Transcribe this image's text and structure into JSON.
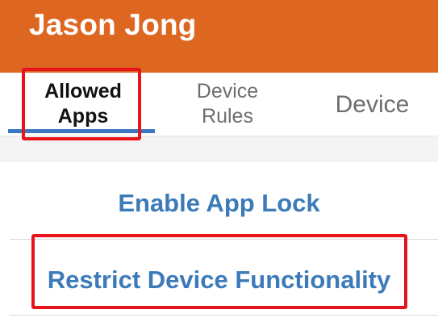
{
  "header": {
    "title": "Jason Jong",
    "background_color": "#dd6621"
  },
  "tabs": [
    {
      "label": "Allowed\nApps",
      "active": true
    },
    {
      "label": "Device\nRules",
      "active": false
    },
    {
      "label": "Device",
      "active": false
    }
  ],
  "actions": {
    "enable_app_lock": "Enable App Lock",
    "restrict_device_functionality": "Restrict Device Functionality"
  },
  "colors": {
    "accent_blue": "#3c7ab9",
    "tab_indicator": "#3b78c2",
    "highlight_red": "#e8141b"
  },
  "highlights": [
    "tab-allowed-apps",
    "restrict-device-functionality-button"
  ]
}
